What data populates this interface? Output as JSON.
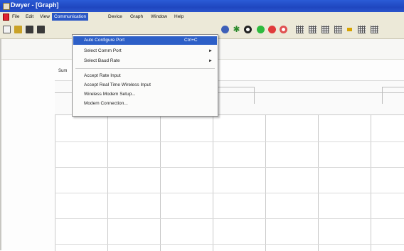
{
  "window": {
    "title": "Dwyer - [Graph]"
  },
  "menubar": {
    "items": [
      "File",
      "Edit",
      "View",
      "Communication",
      "Device",
      "Graph",
      "Window",
      "Help"
    ],
    "active_index": 3
  },
  "dropdown": {
    "items": [
      {
        "label": "Auto Configure Port",
        "shortcut": "Ctrl+C",
        "submenu": false,
        "selected": true
      },
      {
        "label": "Select Comm Port",
        "shortcut": "",
        "submenu": true,
        "selected": false
      },
      {
        "label": "Select Baud Rate",
        "shortcut": "",
        "submenu": true,
        "selected": false
      },
      {
        "label": "Accept Rate Input",
        "shortcut": "",
        "submenu": false,
        "selected": false
      },
      {
        "label": "Accept Real Time Wireless Input",
        "shortcut": "",
        "submenu": false,
        "selected": false
      },
      {
        "label": "Wireless Modem Setup...",
        "shortcut": "",
        "submenu": false,
        "selected": false
      },
      {
        "label": "Modem Connection...",
        "shortcut": "",
        "submenu": false,
        "selected": false
      }
    ],
    "submenu_arrow": "►"
  },
  "document": {
    "tab_label": "Sum"
  },
  "toolbar": {
    "icons": [
      {
        "name": "new-file-icon",
        "color": "#f2f2f2"
      },
      {
        "name": "open-folder-icon",
        "color": "#c9a227"
      },
      {
        "name": "save-icon",
        "color": "#2e2e2e"
      },
      {
        "name": "print-icon",
        "color": "#3a3a3a"
      },
      {
        "name": "help-circle-icon",
        "color": "#3d5fb8"
      },
      {
        "name": "star-icon",
        "color": "#2c8a2c"
      },
      {
        "name": "record-black-icon",
        "color": "#222222"
      },
      {
        "name": "play-green-icon",
        "color": "#2dbb3d"
      },
      {
        "name": "stop-red-icon",
        "color": "#e03a3a"
      },
      {
        "name": "stop-red-outline-icon",
        "color": "#e05050"
      },
      {
        "name": "grid-view-1-icon",
        "color": "#555555"
      },
      {
        "name": "grid-view-2-icon",
        "color": "#555555"
      },
      {
        "name": "grid-view-3-icon",
        "color": "#555555"
      },
      {
        "name": "grid-view-4-icon",
        "color": "#555555"
      },
      {
        "name": "marker-icon",
        "color": "#d7a300"
      },
      {
        "name": "grid-view-5-icon",
        "color": "#555555"
      },
      {
        "name": "grid-view-6-icon",
        "color": "#555555"
      }
    ]
  },
  "colors": {
    "titlebar": "#2451c9",
    "highlight": "#2d5fc7",
    "menu_bg": "#ece9d8"
  }
}
